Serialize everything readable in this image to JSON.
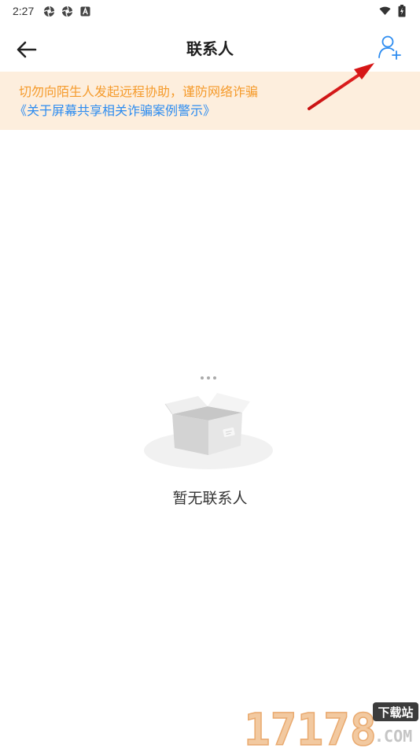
{
  "status_bar": {
    "time": "2:27",
    "left_icons": [
      "aperture-icon",
      "aperture-icon",
      "font-a-icon"
    ],
    "right_icons": [
      "wifi-icon",
      "battery-icon"
    ]
  },
  "app_bar": {
    "title": "联系人",
    "back_icon": "arrow-left-icon",
    "add_icon": "add-person-icon",
    "icon_color": "#2d8cf0"
  },
  "warning": {
    "text": "切勿向陌生人发起远程协助，谨防网络诈骗",
    "link": "《关于屏幕共享相关诈骗案例警示》",
    "bg_color": "#fdeedd",
    "text_color": "#f59b2c",
    "link_color": "#2d8cf0"
  },
  "empty_state": {
    "illustration": "empty-box-icon",
    "text": "暂无联系人"
  },
  "watermark": {
    "number": "17178",
    "badge": "下载站",
    "suffix": ".COM"
  }
}
